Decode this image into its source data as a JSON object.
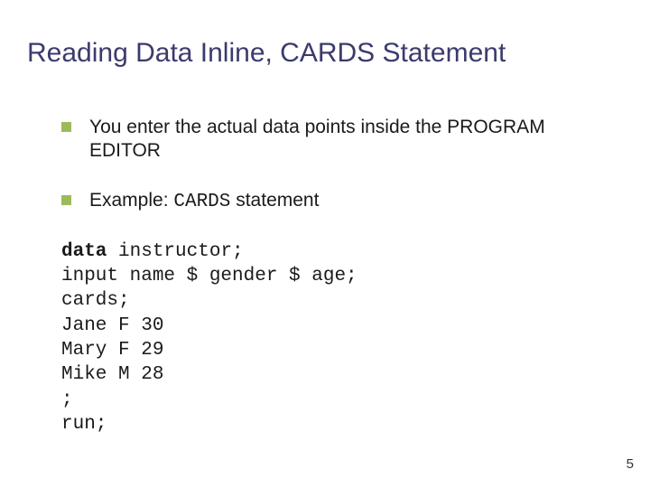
{
  "title": "Reading Data Inline, CARDS Statement",
  "bullets": [
    {
      "text": "You enter the actual data points inside the PROGRAM EDITOR"
    },
    {
      "prefix": "Example: ",
      "mono": "CARDS",
      "suffix": " statement"
    }
  ],
  "code": {
    "l1a": "data",
    "l1b": " instructor;",
    "l2": "input name $ gender $ age;",
    "l3": "cards;",
    "l4": "Jane F 30",
    "l5": "Mary F 29",
    "l6": "Mike M 28",
    "l7": ";",
    "l8": "run;"
  },
  "page": "5"
}
